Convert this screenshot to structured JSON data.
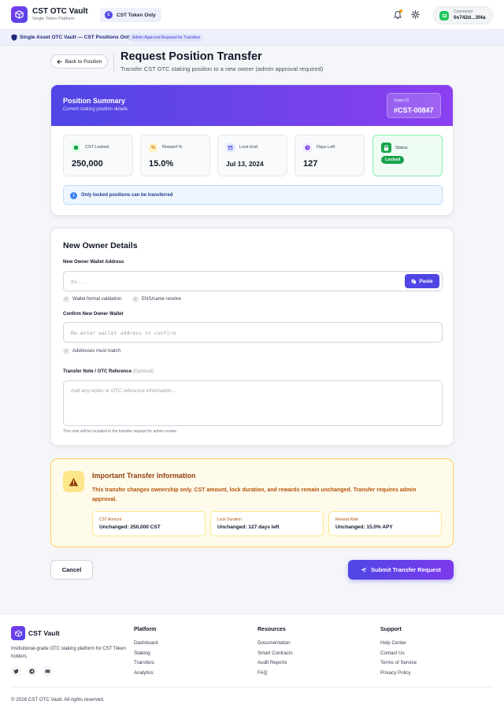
{
  "header": {
    "brand_name": "CST OTC Vault",
    "brand_sub": "Single Token Platform",
    "token_pill": "CST Token Only",
    "token_symbol": "C",
    "wallet_label": "Connected",
    "wallet_address": "0x742d...3f4a"
  },
  "notice": {
    "text": "Single Asset OTC Vault — CST Positions Only",
    "badge": "Admin Approval Required for Transfers"
  },
  "title_area": {
    "back_label": "Back to Position",
    "title": "Request Position Transfer",
    "subtitle": "Transfer CST OTC staking position to a new owner (admin approval required)"
  },
  "summary": {
    "title": "Position Summary",
    "subtitle": "Current staking position details",
    "stake_id_label": "Stake ID",
    "stake_id": "#CST-00847",
    "metrics": [
      {
        "label": "CST Locked",
        "value": "250,000",
        "icon": "coins-icon"
      },
      {
        "label": "Reward %",
        "value": "15.0%",
        "icon": "percent-icon"
      },
      {
        "label": "Lock End",
        "value": "Jul 13, 2024",
        "icon": "calendar-icon"
      },
      {
        "label": "Days Left",
        "value": "127",
        "icon": "clock-icon"
      }
    ],
    "status_label": "Status",
    "status_value": "Locked",
    "info": "Only locked positions can be transferred"
  },
  "owner": {
    "title": "New Owner Details",
    "wallet_label": "New Owner Wallet Address",
    "wallet_placeholder": "0x...",
    "paste_label": "Paste",
    "checks": [
      "Wallet format validation",
      "ENS/name resolve"
    ],
    "confirm_label": "Confirm New Owner Wallet",
    "confirm_placeholder": "Re-enter wallet address to confirm",
    "confirm_check": "Addresses must match",
    "note_label": "Transfer Note / OTC Reference",
    "note_optional": "(Optional)",
    "note_placeholder": "Add any notes or OTC reference information...",
    "note_helper": "This note will be included in the transfer request for admin review"
  },
  "important": {
    "title": "Important Transfer Information",
    "text": "This transfer changes ownership only. CST amount, lock duration, and rewards remain unchanged. Transfer requires admin approval.",
    "boxes": [
      {
        "label": "CST Amount",
        "value": "Unchanged: 250,000 CST"
      },
      {
        "label": "Lock Duration",
        "value": "Unchanged: 127 days left"
      },
      {
        "label": "Reward Rate",
        "value": "Unchanged: 15.0% APY"
      }
    ]
  },
  "actions": {
    "cancel": "Cancel",
    "submit": "Submit Transfer Request"
  },
  "footer": {
    "brand": "CST Vault",
    "description": "Institutional-grade OTC staking platform for CST Token holders.",
    "columns": [
      {
        "title": "Platform",
        "links": [
          "Dashboard",
          "Staking",
          "Transfers",
          "Analytics"
        ]
      },
      {
        "title": "Resources",
        "links": [
          "Documentation",
          "Smart Contracts",
          "Audit Reports",
          "FAQ"
        ]
      },
      {
        "title": "Support",
        "links": [
          "Help Center",
          "Contact Us",
          "Terms of Service",
          "Privacy Policy"
        ]
      }
    ],
    "copyright": "© 2026 CST OTC Vault. All rights reserved."
  },
  "colors": {
    "accent": "#4f46e5",
    "accent_2": "#7c3aed",
    "success": "#16a34a",
    "warning_bg": "#fffbeb",
    "warning_text": "#b45309"
  }
}
